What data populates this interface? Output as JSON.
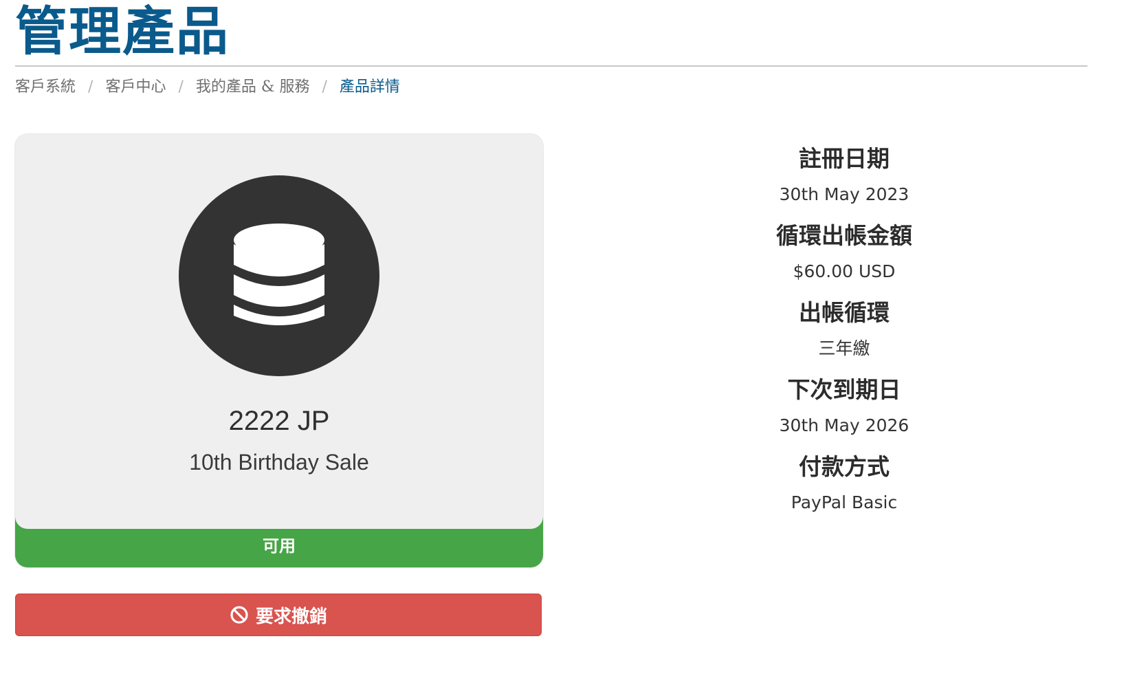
{
  "page_title": "管理產品",
  "breadcrumb": [
    {
      "label": "客戶系統"
    },
    {
      "label": "客戶中心"
    },
    {
      "label": "我的產品 & 服務"
    },
    {
      "label": "產品詳情"
    }
  ],
  "breadcrumb_separator": "/",
  "product": {
    "icon": "database-icon",
    "name": "2222 JP",
    "group": "10th Birthday Sale",
    "status": "可用",
    "status_color": "#46a546"
  },
  "cancel_button": {
    "icon": "ban-icon",
    "label": "要求撤銷",
    "color": "#d9534f"
  },
  "details": [
    {
      "label": "註冊日期",
      "value": "30th May 2023"
    },
    {
      "label": "循環出帳金額",
      "value": "$60.00 USD"
    },
    {
      "label": "出帳循環",
      "value": "三年繳"
    },
    {
      "label": "下次到期日",
      "value": "30th May 2026"
    },
    {
      "label": "付款方式",
      "value": "PayPal Basic"
    }
  ],
  "colors": {
    "title": "#0a5a8c",
    "breadcrumb_active": "#0a5a8c",
    "breadcrumb_link": "#6f6f6f"
  }
}
